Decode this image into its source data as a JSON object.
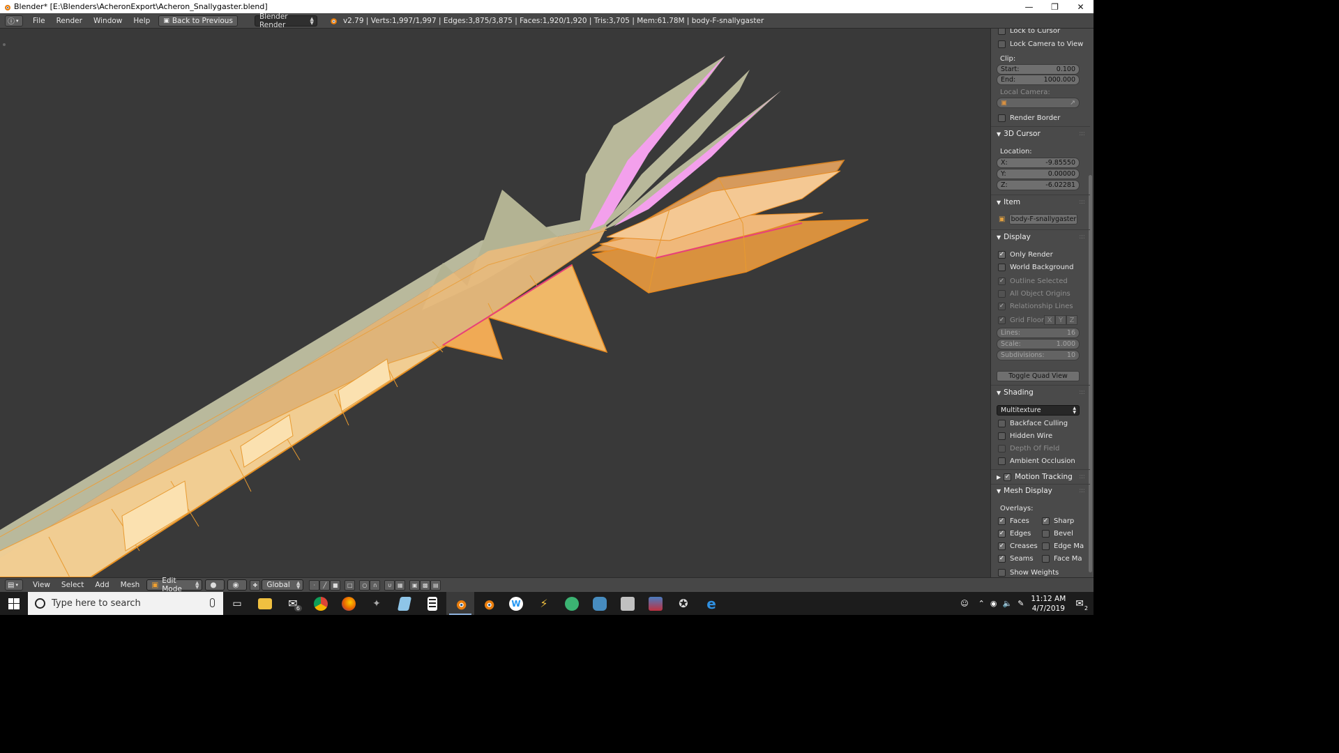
{
  "window": {
    "title": "Blender* [E:\\Blenders\\AcheronExport\\Acheron_Snallygaster.blend]",
    "controls": [
      "minimize",
      "restore",
      "close"
    ]
  },
  "infobar": {
    "menus": [
      "File",
      "Render",
      "Window",
      "Help"
    ],
    "back_button": "Back to Previous",
    "engine": "Blender Render",
    "stats": "v2.79 | Verts:1,997/1,997 | Edges:3,875/3,875 | Faces:1,920/1,920 | Tris:3,705 | Mem:61.78M | body-F-snallygaster"
  },
  "npanel": {
    "lock_to_cursor": "Lock to Cursor",
    "lock_camera": "Lock Camera to View",
    "clip_label": "Clip:",
    "clip_start_key": "Start:",
    "clip_start_val": "0.100",
    "clip_end_key": "End:",
    "clip_end_val": "1000.000",
    "local_camera_label": "Local Camera:",
    "render_border": "Render Border",
    "cursor_header": "3D Cursor",
    "location_label": "Location:",
    "x_key": "X:",
    "x_val": "-9.85550",
    "y_key": "Y:",
    "y_val": "0.00000",
    "z_key": "Z:",
    "z_val": "-6.02281",
    "item_header": "Item",
    "item_name": "body-F-snallygaster",
    "display_header": "Display",
    "only_render": "Only Render",
    "world_background": "World Background",
    "outline_selected": "Outline Selected",
    "all_object_origins": "All Object Origins",
    "relationship_lines": "Relationship Lines",
    "grid_floor": "Grid Floor",
    "axis_x": "X",
    "axis_y": "Y",
    "axis_z": "Z",
    "lines_key": "Lines:",
    "lines_val": "16",
    "scale_key": "Scale:",
    "scale_val": "1.000",
    "subdiv_key": "Subdivisions:",
    "subdiv_val": "10",
    "toggle_quad": "Toggle Quad View",
    "shading_header": "Shading",
    "shading_mode": "Multitexture",
    "backface_culling": "Backface Culling",
    "hidden_wire": "Hidden Wire",
    "depth_of_field": "Depth Of Field",
    "ambient_occlusion": "Ambient Occlusion",
    "motion_tracking": "Motion Tracking",
    "mesh_display_header": "Mesh Display",
    "overlays_label": "Overlays:",
    "faces": "Faces",
    "sharp": "Sharp",
    "edges": "Edges",
    "bevel": "Bevel",
    "creases": "Creases",
    "edge_marks": "Edge Ma",
    "seams": "Seams",
    "face_marks": "Face Ma",
    "show_weights": "Show Weights"
  },
  "vpheader": {
    "menus": [
      "View",
      "Select",
      "Add",
      "Mesh"
    ],
    "mode": "Edit Mode",
    "orientation": "Global"
  },
  "taskbar": {
    "search_placeholder": "Type here to search",
    "mail_badge": "6",
    "time": "11:12 AM",
    "date": "4/7/2019",
    "notification_count": "2"
  },
  "colors": {
    "viewport_bg": "#393939",
    "mesh_selected": "#f0a030",
    "mesh_face": "#e8b874",
    "mesh_unselected": "#b8b89a",
    "pink": "#f09ae8"
  }
}
